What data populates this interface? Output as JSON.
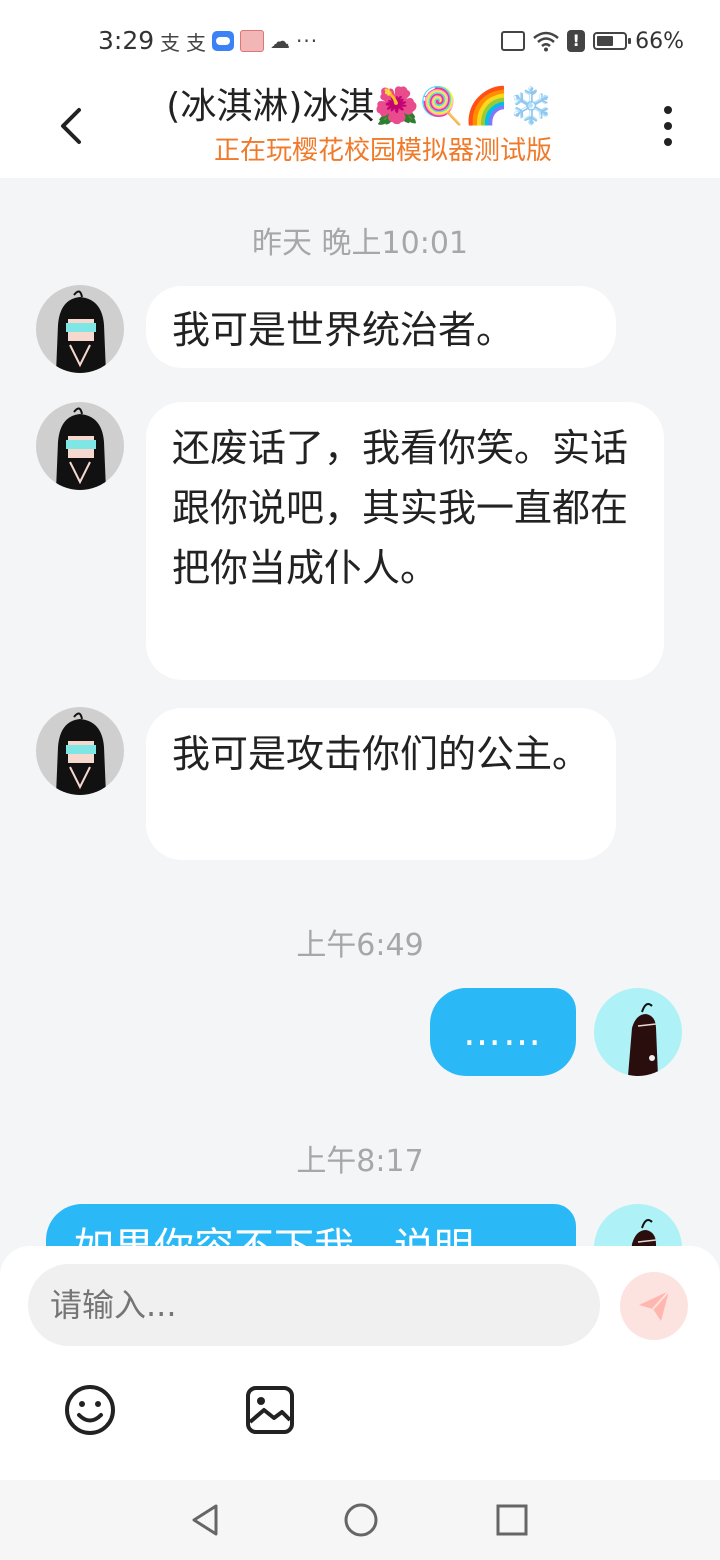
{
  "status_bar": {
    "time": "3:29",
    "battery": "66%",
    "battery_level": 0.66,
    "left_icons": [
      "alipay-icon",
      "alipay-icon",
      "cloud-icon",
      "app-box-icon",
      "wechat-icon",
      "more-dots-icon"
    ],
    "right_icons": [
      "screen-cast-icon",
      "wifi-icon",
      "alert-icon",
      "battery-icon"
    ]
  },
  "header": {
    "title": "(冰淇淋)冰淇🌺🍭🌈❄️",
    "subtitle": "正在玩樱花校园模拟器测试版",
    "back_icon": "chevron-left-icon",
    "more_icon": "vertical-dots-icon",
    "subtitle_color": "#f07a2a"
  },
  "messages": [
    {
      "type": "timestamp",
      "text": "昨天 晚上10:01"
    },
    {
      "type": "message",
      "side": "left",
      "text": "我可是世界统治者。"
    },
    {
      "type": "message",
      "side": "left",
      "text": "还废话了，我看你笑。实话跟你说吧，其实我一直都在把你当成仆人。"
    },
    {
      "type": "message",
      "side": "left",
      "text": "我可是攻击你们的公主。"
    },
    {
      "type": "timestamp",
      "text": "上午6:49"
    },
    {
      "type": "message",
      "side": "right",
      "text": "……"
    },
    {
      "type": "timestamp",
      "text": "上午8:17"
    },
    {
      "type": "message",
      "side": "right",
      "text": "如果你容不下我，说明"
    }
  ],
  "composer": {
    "placeholder": "请输入...",
    "send_icon": "send-icon",
    "emoji_icon": "emoji-icon",
    "image_icon": "image-icon"
  },
  "nav_bar": {
    "icons": [
      "nav-back-icon",
      "nav-home-icon",
      "nav-recent-icon"
    ]
  },
  "colors": {
    "outgoing_bubble": "#2bb8f7",
    "incoming_bubble": "#ffffff",
    "background": "#f4f5f7",
    "send_button": "#fde3df",
    "send_icon": "#ffb6ae"
  }
}
